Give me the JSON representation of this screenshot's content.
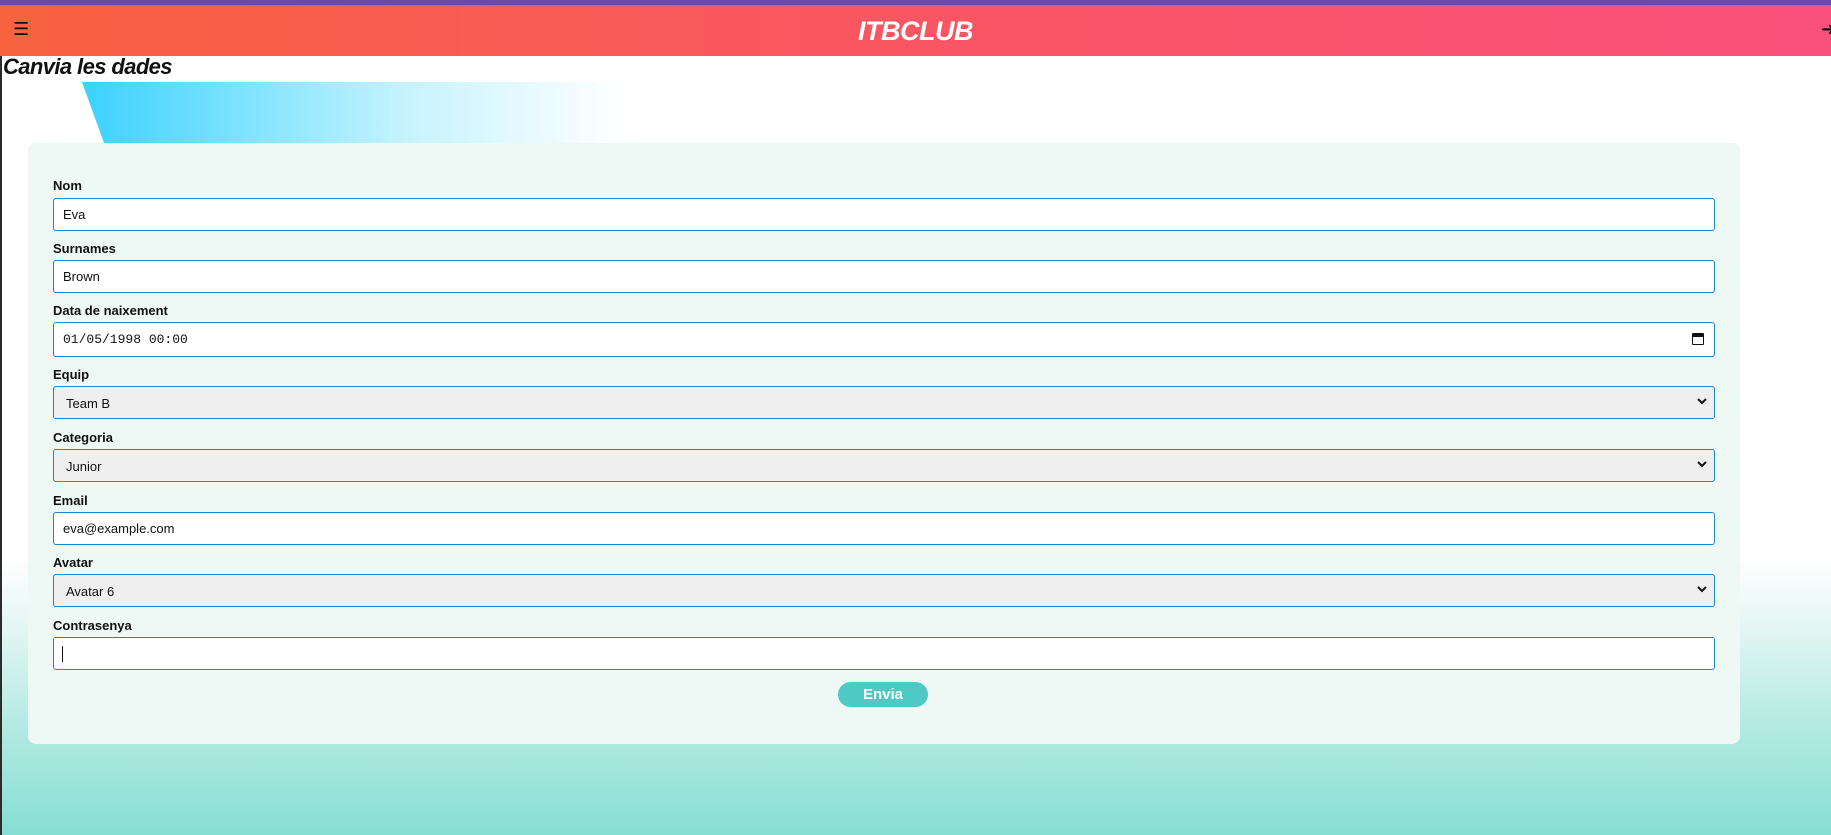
{
  "header": {
    "brand": "ITBCLUB",
    "menu_icon": "hamburger-menu-icon",
    "logout_icon": "logout-arrow-icon",
    "gradient_colors": [
      "#f7623f",
      "#f9517c"
    ]
  },
  "page": {
    "title": "Canvia les dades"
  },
  "form": {
    "nom": {
      "label": "Nom",
      "value": "Eva"
    },
    "surnames": {
      "label": "Surnames",
      "value": "Brown"
    },
    "birthdate": {
      "label": "Data de naixement",
      "value": "01/05/1998 00:00"
    },
    "equip": {
      "label": "Equip",
      "value": "Team B"
    },
    "categoria": {
      "label": "Categoria",
      "value": "Junior"
    },
    "email": {
      "label": "Email",
      "value": "eva@example.com"
    },
    "avatar": {
      "label": "Avatar",
      "value": "Avatar 6"
    },
    "password": {
      "label": "Contrasenya",
      "value": ""
    },
    "submit_label": "Envia"
  },
  "colors": {
    "accent": "#1e88c8",
    "button": "#4fc9c3",
    "card_bg": "#eef8f4"
  }
}
